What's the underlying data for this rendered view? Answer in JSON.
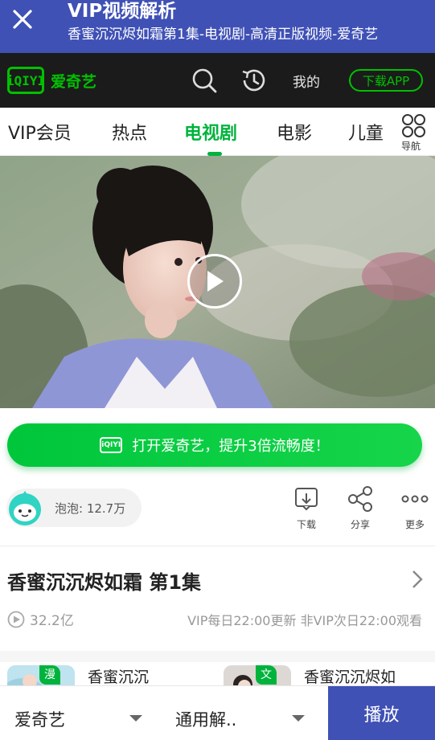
{
  "app_bar": {
    "title": "VIP视频解析",
    "subtitle": "香蜜沉沉烬如霜第1集-电视剧-高清正版视频-爱奇艺"
  },
  "header": {
    "logo_mark": "iQIYI",
    "logo_text": "爱奇艺",
    "mine_label": "我的",
    "download_label": "下载APP"
  },
  "nav": {
    "tabs": [
      {
        "label": "VIP会员",
        "active": false
      },
      {
        "label": "热点",
        "active": false
      },
      {
        "label": "电视剧",
        "active": true
      },
      {
        "label": "电影",
        "active": false
      },
      {
        "label": "儿童",
        "active": false
      }
    ],
    "guide_label": "导航"
  },
  "video": {
    "play_icon": "play-circle-icon"
  },
  "open_app": {
    "logo_mark": "iQIYI",
    "label": "打开爱奇艺，提升3倍流畅度！"
  },
  "bubble": {
    "label": "泡泡: 12.7万"
  },
  "actions": [
    {
      "label": "下载",
      "icon": "download-icon"
    },
    {
      "label": "分享",
      "icon": "share-icon"
    },
    {
      "label": "更多",
      "icon": "more-icon"
    }
  ],
  "episode": {
    "title": "香蜜沉沉烬如霜 第1集",
    "views": "32.2亿",
    "schedule": "VIP每日22:00更新 非VIP次日22:00观看"
  },
  "related": [
    {
      "badge": "漫画",
      "name": "香蜜沉沉"
    },
    {
      "badge": "文学",
      "name": "香蜜沉沉烬如"
    }
  ],
  "bottom_bar": {
    "source": "爱奇艺",
    "parser": "通用解..",
    "play": "播放"
  },
  "colors": {
    "app_bar": "#3f51b5",
    "brand_green": "#00b33c",
    "header_bg": "#1b1b1b"
  }
}
